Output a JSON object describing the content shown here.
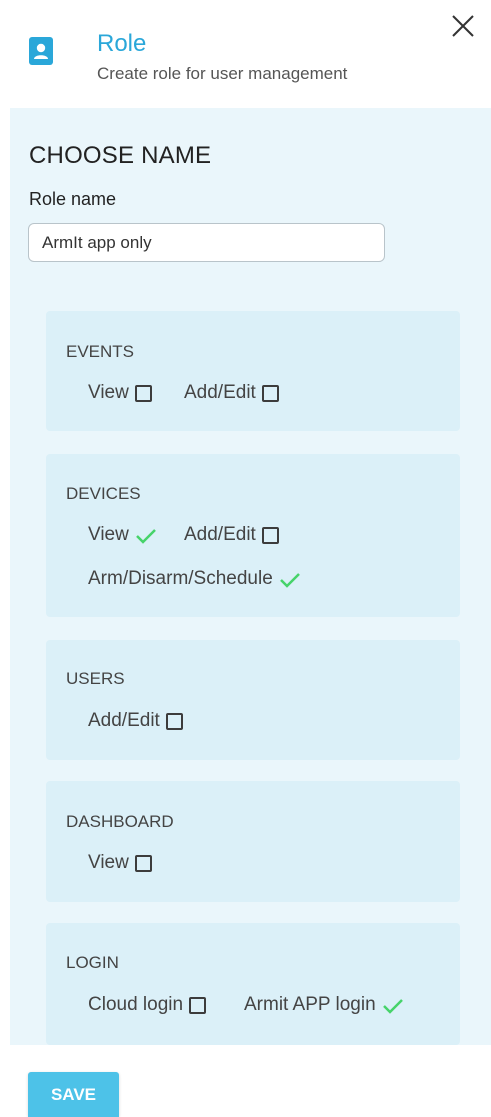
{
  "header": {
    "title": "Role",
    "subtitle": "Create role for user management",
    "icon": "user-badge-icon",
    "accent_color": "#2aa7d9"
  },
  "form": {
    "section_title": "CHOOSE NAME",
    "role_name_label": "Role name",
    "role_name_value": "ArmIt app only"
  },
  "permissions": {
    "events": {
      "title": "EVENTS",
      "view": {
        "label": "View",
        "checked": false
      },
      "add_edit": {
        "label": "Add/Edit",
        "checked": false
      }
    },
    "devices": {
      "title": "DEVICES",
      "view": {
        "label": "View",
        "checked": true
      },
      "add_edit": {
        "label": "Add/Edit",
        "checked": false
      },
      "arm_disarm_schedule": {
        "label": "Arm/Disarm/Schedule",
        "checked": true
      }
    },
    "users": {
      "title": "USERS",
      "add_edit": {
        "label": "Add/Edit",
        "checked": false
      }
    },
    "dashboard": {
      "title": "DASHBOARD",
      "view": {
        "label": "View",
        "checked": false
      }
    },
    "login": {
      "title": "LOGIN",
      "cloud_login": {
        "label": "Cloud login",
        "checked": false
      },
      "armit_app_login": {
        "label": "Armit APP login",
        "checked": true
      }
    }
  },
  "actions": {
    "save_label": "SAVE",
    "save_color": "#4dc2e8"
  },
  "colors": {
    "panel_bg": "#eaf6fb",
    "card_bg": "#dbf0f8",
    "check_color": "#46d36a"
  }
}
